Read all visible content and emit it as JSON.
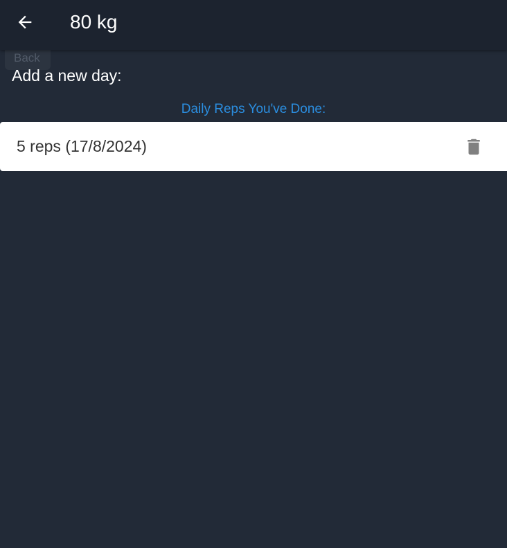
{
  "header": {
    "title": "80 kg",
    "back_icon": "arrow-left-icon",
    "back_tooltip": "Back"
  },
  "form": {
    "add_day_label": "Add a new day:"
  },
  "reps_list": {
    "header": "Daily Reps You've Done:",
    "items": [
      {
        "label": "5 reps (17/8/2024)",
        "delete_icon": "trash-icon"
      }
    ]
  },
  "colors": {
    "background": "#222a37",
    "app_bar": "#1c232f",
    "accent": "#2b8ee0",
    "row_background": "#ffffff",
    "icon_gray": "#808080"
  }
}
